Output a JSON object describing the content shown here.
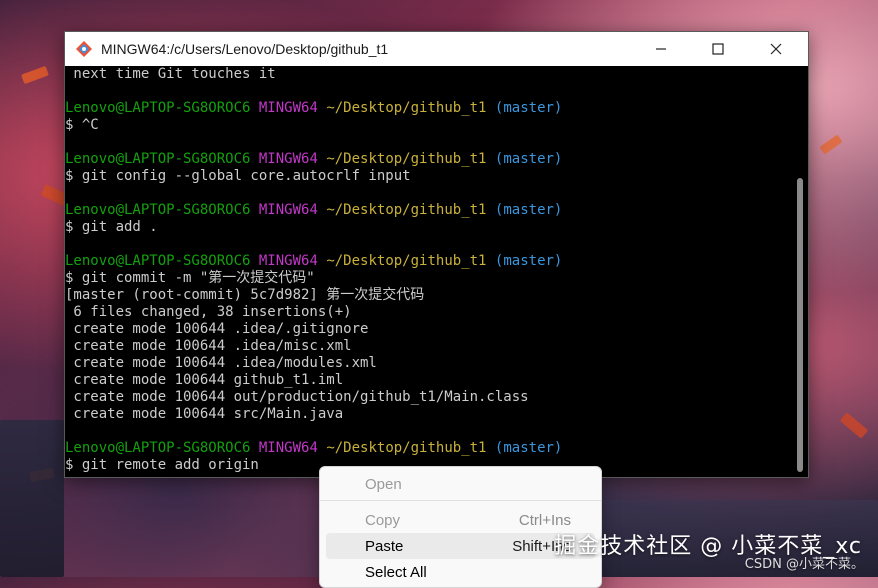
{
  "window": {
    "title": "MINGW64:/c/Users/Lenovo/Desktop/github_t1",
    "controls": {
      "minimize": "minimize",
      "maximize": "maximize",
      "close": "close"
    }
  },
  "terminal": {
    "lines": [
      {
        "text": " next time Git touches it"
      },
      {
        "text": ""
      },
      {
        "prompt": {
          "user": "Lenovo@LAPTOP-SG8OROC6",
          "env": "MINGW64",
          "path": "~/Desktop/github_t1",
          "branch": "(master)"
        }
      },
      {
        "text": "$ ^C"
      },
      {
        "text": ""
      },
      {
        "prompt": {
          "user": "Lenovo@LAPTOP-SG8OROC6",
          "env": "MINGW64",
          "path": "~/Desktop/github_t1",
          "branch": "(master)"
        }
      },
      {
        "text": "$ git config --global core.autocrlf input"
      },
      {
        "text": ""
      },
      {
        "prompt": {
          "user": "Lenovo@LAPTOP-SG8OROC6",
          "env": "MINGW64",
          "path": "~/Desktop/github_t1",
          "branch": "(master)"
        }
      },
      {
        "text": "$ git add ."
      },
      {
        "text": ""
      },
      {
        "prompt": {
          "user": "Lenovo@LAPTOP-SG8OROC6",
          "env": "MINGW64",
          "path": "~/Desktop/github_t1",
          "branch": "(master)"
        }
      },
      {
        "text": "$ git commit -m \"第一次提交代码\""
      },
      {
        "text": "[master (root-commit) 5c7d982] 第一次提交代码"
      },
      {
        "text": " 6 files changed, 38 insertions(+)"
      },
      {
        "text": " create mode 100644 .idea/.gitignore"
      },
      {
        "text": " create mode 100644 .idea/misc.xml"
      },
      {
        "text": " create mode 100644 .idea/modules.xml"
      },
      {
        "text": " create mode 100644 github_t1.iml"
      },
      {
        "text": " create mode 100644 out/production/github_t1/Main.class"
      },
      {
        "text": " create mode 100644 src/Main.java"
      },
      {
        "text": ""
      },
      {
        "prompt": {
          "user": "Lenovo@LAPTOP-SG8OROC6",
          "env": "MINGW64",
          "path": "~/Desktop/github_t1",
          "branch": "(master)"
        }
      },
      {
        "text": "$ git remote add origin"
      }
    ]
  },
  "context_menu": {
    "open": "Open",
    "copy": "Copy",
    "copy_shortcut": "Ctrl+Ins",
    "paste": "Paste",
    "paste_shortcut": "Shift+Ins",
    "select_all": "Select All"
  },
  "watermark": {
    "main": "掘金技术社区 @ 小菜不菜_xc",
    "csdn": "CSDN @小菜不菜。"
  },
  "colors": {
    "prompt_user": "#13a10e",
    "prompt_env": "#c138c7",
    "prompt_path": "#c9b13a",
    "prompt_branch": "#3a96dd",
    "terminal_text": "#cccccc"
  }
}
